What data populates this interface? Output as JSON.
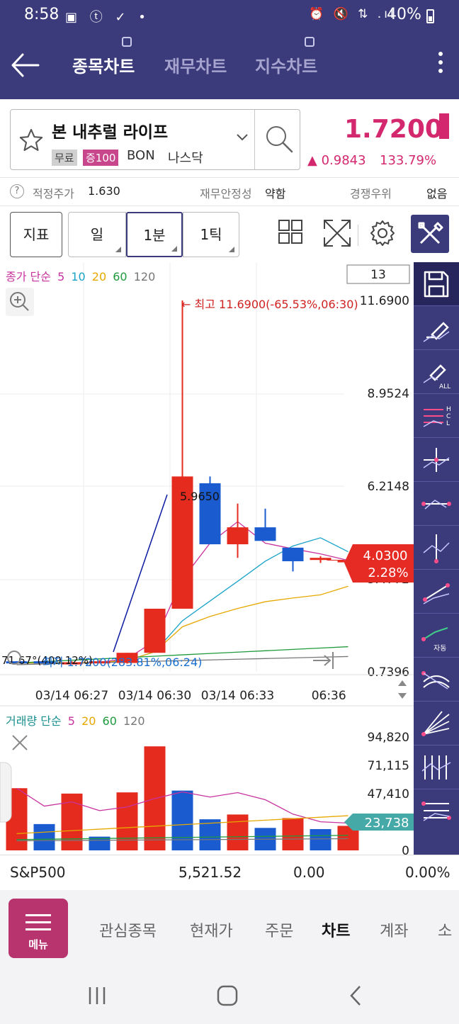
{
  "status_bar": {
    "time": "8:58",
    "icons_left": "▣ ⓣ ✓ •",
    "icons_right": "⏰ 🔇 ⇅ .ıl",
    "battery": "40%"
  },
  "header": {
    "tabs": [
      {
        "label": "종목차트",
        "active": true
      },
      {
        "label": "재무차트",
        "active": false
      },
      {
        "label": "지수차트",
        "active": false
      }
    ]
  },
  "stock": {
    "name": "본 내추럴 라이프",
    "tag_free": "무료",
    "tag_margin": "증100",
    "ticker": "BON",
    "exchange": "나스닥",
    "price": "1.7200",
    "change": "▲ 0.9843",
    "change_pct": "133.79%"
  },
  "info_row": {
    "fair_price_label": "적정주가",
    "fair_price_value": "1.630",
    "financial_label": "재무안정성",
    "financial_value": "약함",
    "competitive_label": "경쟁우위",
    "competitive_value": "없음"
  },
  "toolbar": {
    "indicator_label": "지표",
    "day_label": "일",
    "min_label": "1분",
    "tick_label": "1틱"
  },
  "chart_data": [
    {
      "type": "candlestick",
      "title": "",
      "ma_legend": {
        "prefix": "종가 단순",
        "periods": [
          "5",
          "10",
          "20",
          "60",
          "120"
        ],
        "colors": [
          "#c8329e",
          "#1aa3c8",
          "#e6a800",
          "#1f9a3c",
          "#777777"
        ]
      },
      "count_box": "13",
      "y_ticks": [
        "11.6900",
        "8.9524",
        "6.2148",
        "3.4772",
        "0.7396"
      ],
      "ylim": [
        0.7396,
        11.69
      ],
      "x_ticks": [
        "03/14 06:27",
        "03/14 06:30",
        "03/14 06:33",
        "06:36"
      ],
      "high_annotation": "← 최고 11.6900(-65.53%,06:30)",
      "low_annotation": "71.67°(409.12%)",
      "low_annotation_blue": "최저 1.7200(283.81%,06:24)",
      "point_annotation": "5.9650",
      "current_price": "4.0300",
      "current_pct": "2.28%",
      "candles": [
        {
          "o": 1.05,
          "h": 1.05,
          "l": 1.0,
          "c": 1.0,
          "up": false
        },
        {
          "o": 1.05,
          "h": 1.08,
          "l": 1.0,
          "c": 1.0,
          "up": false
        },
        {
          "o": 1.0,
          "h": 1.05,
          "l": 0.98,
          "c": 1.02,
          "up": true
        },
        {
          "o": 1.02,
          "h": 1.08,
          "l": 1.0,
          "c": 1.05,
          "up": true
        },
        {
          "o": 1.0,
          "h": 1.3,
          "l": 0.98,
          "c": 1.3,
          "up": true
        },
        {
          "o": 1.3,
          "h": 2.6,
          "l": 1.3,
          "c": 2.6,
          "up": true
        },
        {
          "o": 2.6,
          "h": 11.69,
          "l": 2.6,
          "c": 6.5,
          "up": true
        },
        {
          "o": 6.3,
          "h": 6.5,
          "l": 4.5,
          "c": 4.5,
          "up": false
        },
        {
          "o": 5.0,
          "h": 5.7,
          "l": 4.1,
          "c": 4.5,
          "up": true
        },
        {
          "o": 5.0,
          "h": 5.55,
          "l": 4.6,
          "c": 4.6,
          "up": false
        },
        {
          "o": 4.4,
          "h": 4.4,
          "l": 3.7,
          "c": 4.0,
          "up": false
        },
        {
          "o": 4.1,
          "h": 4.15,
          "l": 3.95,
          "c": 4.05,
          "up": true
        },
        {
          "o": 4.03,
          "h": 4.07,
          "l": 3.99,
          "c": 4.03,
          "up": true
        }
      ]
    },
    {
      "type": "bar",
      "title": "",
      "legend": {
        "prefix": "거래량 단순",
        "periods": [
          "5",
          "20",
          "60",
          "120"
        ],
        "colors": [
          "#c8329e",
          "#e6a800",
          "#1f9a3c",
          "#777777"
        ]
      },
      "y_ticks": [
        "94,820",
        "71,115",
        "47,410",
        "23,738",
        "0"
      ],
      "ylim": [
        0,
        94820
      ],
      "current_volume": "23,738",
      "values": [
        52000,
        22000,
        47500,
        11500,
        48500,
        87000,
        50000,
        26000,
        30000,
        18800,
        27000,
        17800,
        20500
      ],
      "up": [
        true,
        false,
        true,
        false,
        true,
        true,
        false,
        false,
        true,
        false,
        true,
        false,
        true
      ]
    }
  ],
  "index_row": {
    "name": "S&P500",
    "value": "5,521.52",
    "change": "0.00",
    "change_pct": "0.00%"
  },
  "bottom_nav": {
    "menu_label": "메뉴",
    "items": [
      "관심종목",
      "현재가",
      "주문",
      "차트",
      "계좌",
      "소"
    ]
  }
}
